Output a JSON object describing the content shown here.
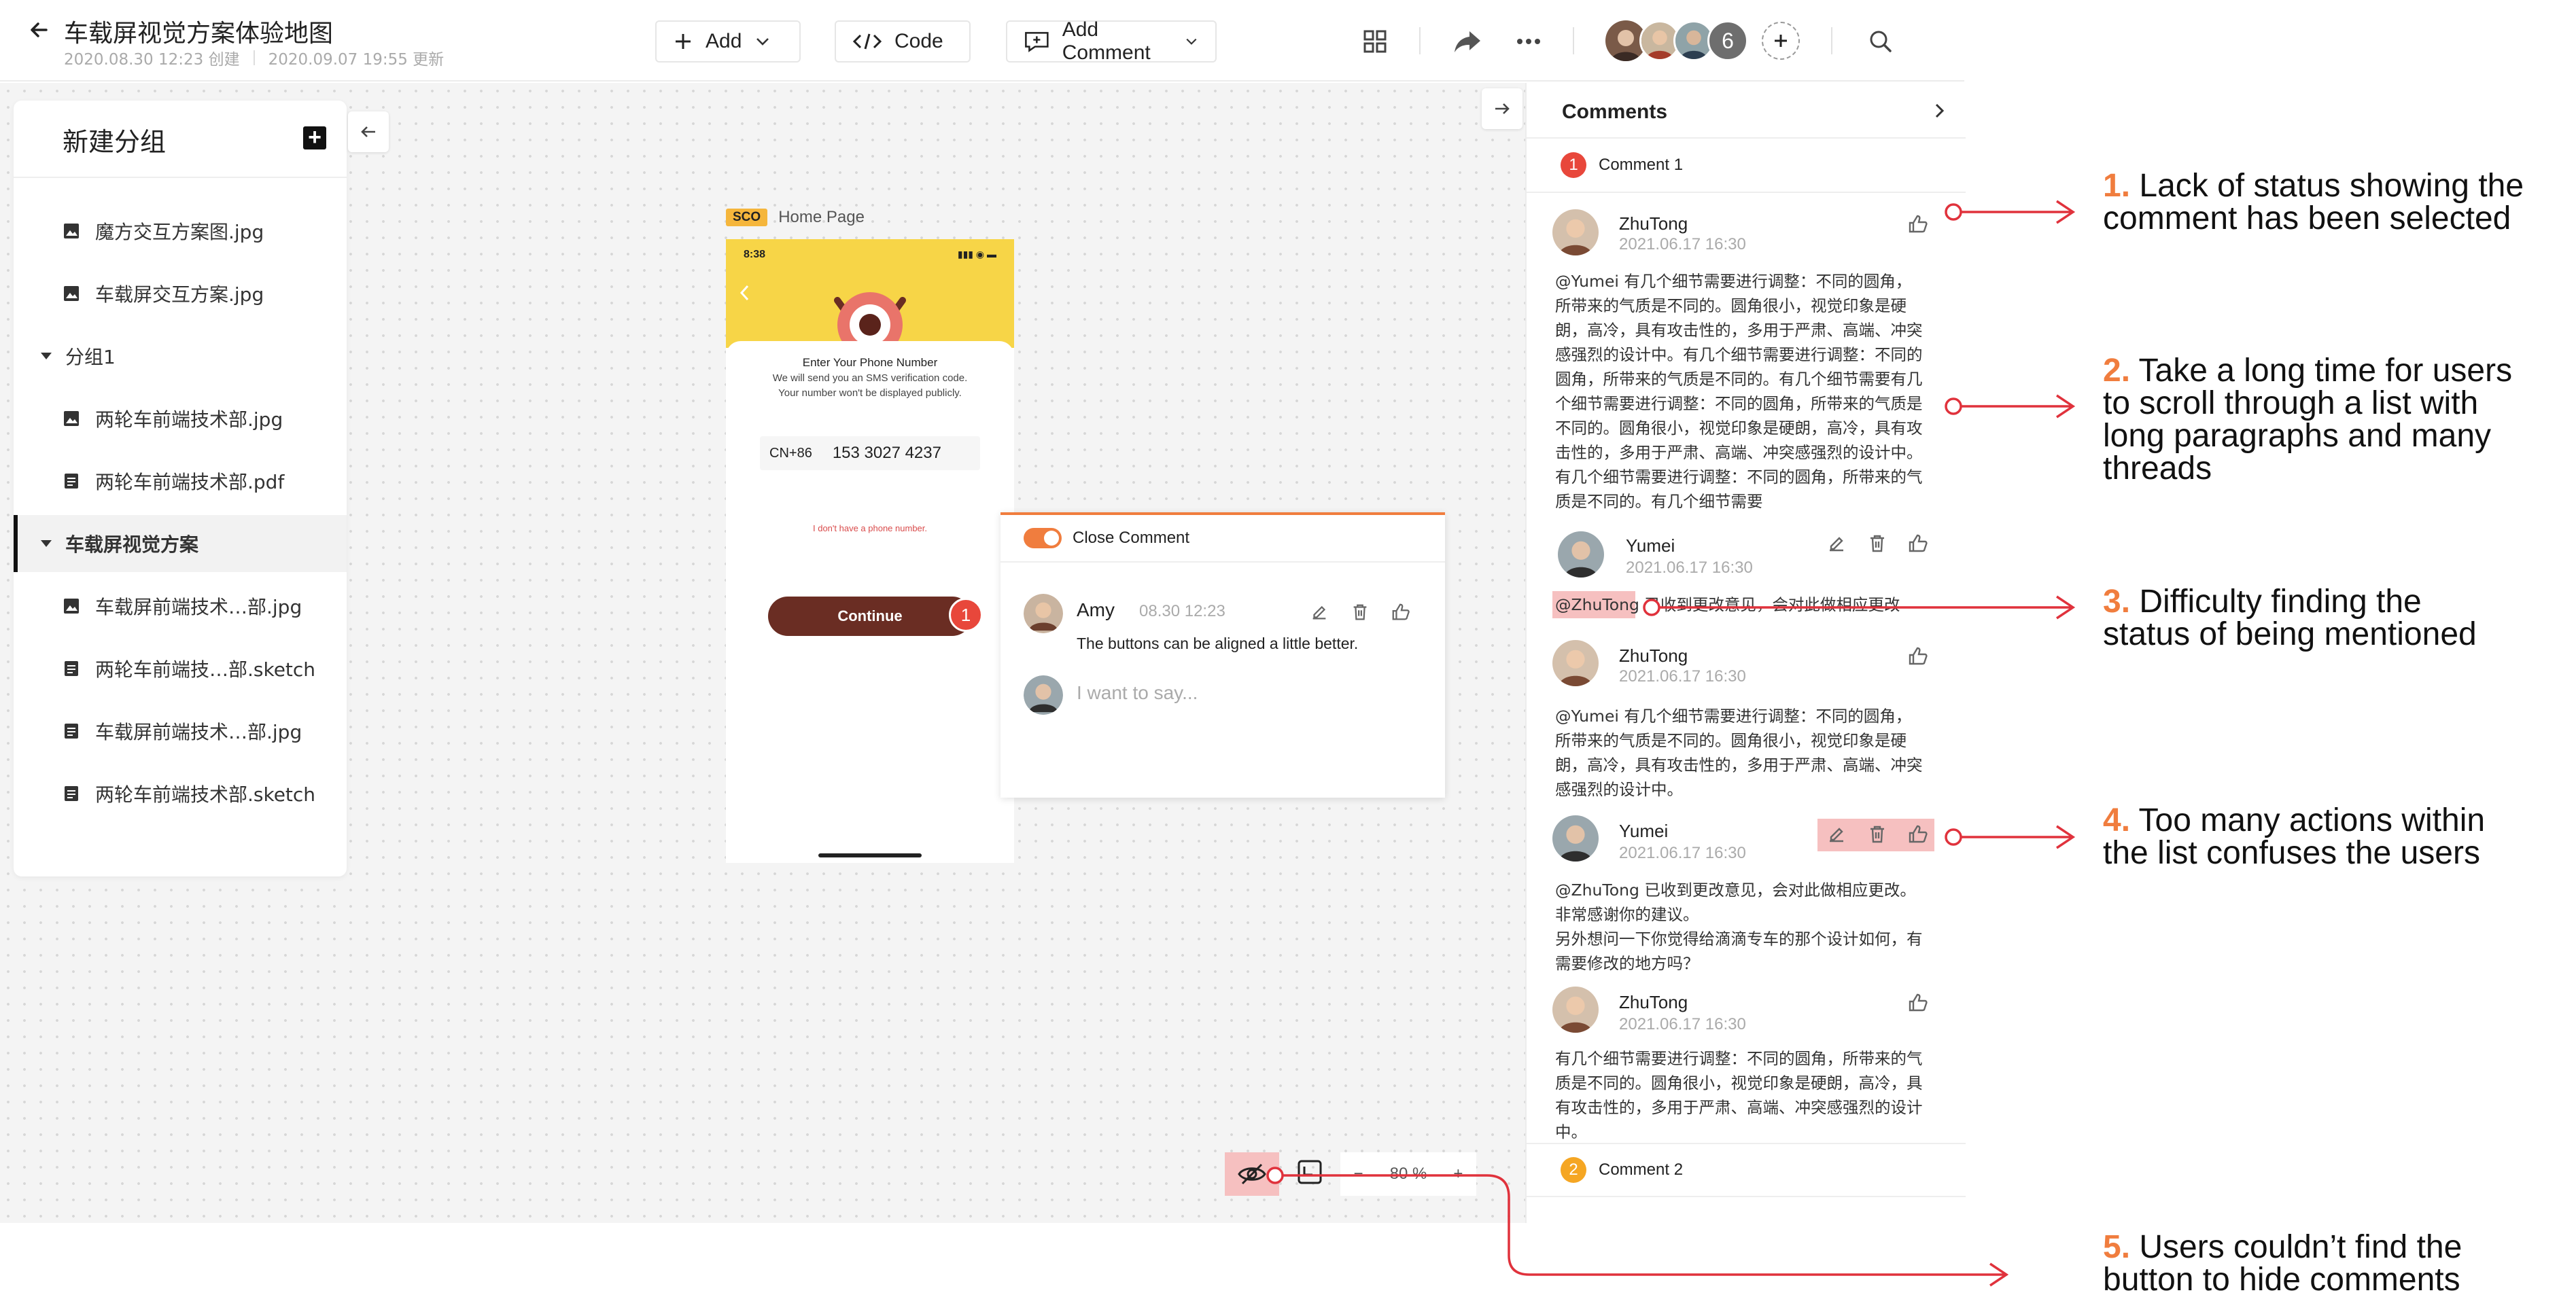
{
  "header": {
    "title": "车载屏视觉方案体验地图",
    "created": "2020.08.30 12:23 创建",
    "updated": "2020.09.07 19:55 更新",
    "add_label": "Add",
    "code_label": "Code",
    "add_comment_label": "Add Comment",
    "member_count": "6"
  },
  "sidebar": {
    "title": "新建分组",
    "items": [
      {
        "label": "魔方交互方案图.jpg",
        "icon": "image-file-icon"
      },
      {
        "label": "车载屏交互方案.jpg",
        "icon": "image-file-icon"
      },
      {
        "label": "分组1",
        "icon": "caret-down-icon"
      },
      {
        "label": "两轮车前端技术部.jpg",
        "icon": "image-file-icon"
      },
      {
        "label": "两轮车前端技术部.pdf",
        "icon": "doc-file-icon"
      },
      {
        "label": "车载屏视觉方案",
        "icon": "caret-down-icon"
      },
      {
        "label": "车载屏前端技术…部.jpg",
        "icon": "image-file-icon"
      },
      {
        "label": "两轮车前端技…部.sketch",
        "icon": "doc-file-icon"
      },
      {
        "label": "车载屏前端技术…部.jpg",
        "icon": "image-file-icon"
      },
      {
        "label": "两轮车前端技术部.sketch",
        "icon": "doc-file-icon"
      }
    ]
  },
  "artboard": {
    "tag": "SCO",
    "name": "Home Page",
    "status_time": "8:38",
    "heading": "Enter Your Phone Number",
    "sub1": "We will send you an SMS verification code.",
    "sub2": "Your number won't be displayed publicly.",
    "country_code": "CN+86",
    "phone_number": "153 3027 4237",
    "no_phone": "I don't have a phone number.",
    "continue": "Continue",
    "pin": "1"
  },
  "popup": {
    "toggle_label": "Close Comment",
    "author": "Amy",
    "time": "08.30 12:23",
    "text": "The buttons can be aligned a little better.",
    "placeholder": "I want to say..."
  },
  "zoom": {
    "minus": "−",
    "value": "80 %",
    "plus": "+"
  },
  "comments": {
    "title": "Comments",
    "group1": {
      "num": "1",
      "label": "Comment 1"
    },
    "group2": {
      "num": "2",
      "label": "Comment 2"
    },
    "c1": {
      "author": "ZhuTong",
      "time": "2021.06.17 16:30",
      "lines": [
        "@Yumei 有几个细节需要进行调整：不同的圆角，",
        "所带来的气质是不同的。圆角很小，视觉印象是硬",
        "朗，高冷，具有攻击性的，多用于严肃、高端、冲突",
        "感强烈的设计中。有几个细节需要进行调整：不同的",
        "圆角，所带来的气质是不同的。有几个细节需要有几",
        "个细节需要进行调整：不同的圆角，所带来的气质是",
        "不同的。圆角很小，视觉印象是硬朗，高冷，具有攻",
        "击性的，多用于严肃、高端、冲突感强烈的设计中。",
        "有几个细节需要进行调整：不同的圆角，所带来的气",
        "质是不同的。有几个细节需要"
      ]
    },
    "c2": {
      "author": "Yumei",
      "time": "2021.06.17 16:30",
      "lines": [
        "@ZhuTong 已收到更改意见，会对此做相应更改"
      ]
    },
    "c3": {
      "author": "ZhuTong",
      "time": "2021.06.17 16:30",
      "lines": [
        "@Yumei 有几个细节需要进行调整：不同的圆角，",
        "所带来的气质是不同的。圆角很小，视觉印象是硬",
        "朗，高冷，具有攻击性的，多用于严肃、高端、冲突",
        "感强烈的设计中。"
      ]
    },
    "c4": {
      "author": "Yumei",
      "time": "2021.06.17 16:30",
      "lines": [
        "@ZhuTong 已收到更改意见，会对此做相应更改。",
        "非常感谢你的建议。",
        "另外想问一下你觉得给滴滴专车的那个设计如何，有",
        "需要修改的地方吗？"
      ]
    },
    "c5": {
      "author": "ZhuTong",
      "time": "2021.06.17 16:30",
      "lines": [
        "有几个细节需要进行调整：不同的圆角，所带来的气",
        "质是不同的。圆角很小，视觉印象是硬朗，高冷，具",
        "有攻击性的，多用于严肃、高端、冲突感强烈的设计",
        "中。"
      ]
    }
  },
  "annotations": [
    {
      "num": "1.",
      "lines": [
        "Lack of status showing the",
        "comment has been selected"
      ]
    },
    {
      "num": "2.",
      "lines": [
        "Take a long time for users",
        "to scroll through a list with",
        "long paragraphs and many",
        "threads"
      ]
    },
    {
      "num": "3.",
      "lines": [
        "Difficulty finding the",
        "status of being mentioned"
      ]
    },
    {
      "num": "4.",
      "lines": [
        "Too many actions within",
        "the list confuses the users"
      ]
    },
    {
      "num": "5.",
      "lines": [
        "Users couldn’t find the",
        "button to hide comments"
      ]
    }
  ],
  "colors": {
    "accent_orange": "#f07d3e",
    "pin_red": "#e8473b",
    "group2_orange": "#f5a623",
    "highlight_pink": "#f6c0c0",
    "annotation_line": "#e0323c"
  }
}
